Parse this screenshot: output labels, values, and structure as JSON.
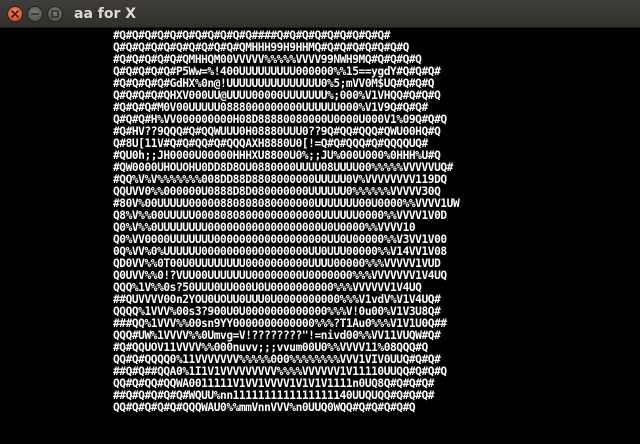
{
  "window": {
    "title": "aa for X"
  },
  "icons": {
    "close": "close-icon",
    "minimize": "minimize-icon",
    "maximize": "maximize-icon"
  },
  "colors": {
    "titlebar": "#3c3b37",
    "title_text": "#dfdbd2",
    "close_button": "#e4582f",
    "background": "#000000",
    "ascii_text": "#ffffff"
  },
  "ascii_art": [
    "#Q#Q#Q#Q#Q#Q#Q#Q#Q#Q#Q####Q#Q#Q#Q#Q#Q#Q#Q#Q#",
    "Q#Q#Q#Q#Q#Q#Q#Q#Q#Q#QMHHH99H9HHMQ#Q#Q#Q#Q#Q#Q#Q",
    "#Q#Q#Q#Q#Q#QMHHQM00VVVVV%%%%%VVVV99NWH9MQ#Q#Q#Q#Q",
    "Q#Q#Q#Q#Q#P5Ww=%!400UUUUUUUUU000000%%15==ygdY#Q#Q#Q#",
    "#Q#Q#Q#Q#GdHX%0n@!UUUUUUUUUUUUUUU0%5;mVV0M$UQ#Q#Q#Q",
    "Q#Q#Q#Q#QHXV000UU@UUUU00000UUUUUUU%;000%V1VHQQ#Q#Q#Q",
    "#Q#Q#Q#M0V00UUUUU0888000000000UUUUUU000%V1V9Q#Q#Q#",
    "Q#Q#Q#H%VV000000000H08D88880080000U0000U000V1%09Q#Q#Q",
    "#Q#HV??9QQQ#Q#QQWUUU0H08880UUU0??9Q#QQ#QQQ#QWU00HQ#Q",
    "Q#8U[11V#Q#Q#QQ#Q#QQQAXH8880U0[!=Q#Q#QQQ#Q#QQQQUQ#",
    "#QU0h;;JH0000U00000HHHXU8800U0%;;JU%000U000%0HHH%U#Q",
    "#QW0000UHOUOHU0DD8D8OU0880000UUUU08UUUU00%%%%%VVVVVUQ#",
    "#QQ%V%V%%%%%%%008DD88D8808000000UUUUU0V%VVVVVVVV119DQ",
    "QQUVV0%%000000U0888D8D080000000UUUUUU0%%%%%%VVVVV30Q",
    "#80V%00UUUUU00000880808080000000UUUUUUU00U0000%%VVVV1UW",
    "Q8%V%%00UUUUU00080808000000000000UUUUUU0000%%VVVV1V0D",
    "Q0%V%%0UUUUUUUU000000000000000000U0U0000%%VVVV10",
    "Q0%VV0000UUUUUUU000000000000000000UU0U00000%%V3VV1V00",
    "0Q%VV%0%UUUUUU00000000000000000UU0UUU00000%%V14VV1V08",
    "QD0VV%%0T00U0UUUUUUUU0000000000UUUU00000%%%VVVVV1VUD",
    "Q0UVV%%0!?VUU00UUUUUUU00000000U0000000%%%VVVVVVV1V4UQ",
    "QQQ%1V%%0s?50UUU0UU000U0U0000000000%%%VVVVVV1V4UQ",
    "##QUVVVV00n2YOU0UOUU0UUU0U0000000000%%%V1vdV%V1V4UQ#",
    "QQQQ%1VVV%00s3?900U0U0000000000000%%%V!0u00%V1V3U8Q#",
    "###QQ%1VVV%%00sn9YY0000000000000%%%?T1Au0%%%V1V1U0Q##",
    "QQQ#UW%1VVVV%%0Umvg=V!????????\"!=nivd00%%VV11VUQW#Q#",
    "#Q#QQUOV11VVVV%%000nuvv;;;vvum00U0%%VVVV11%08QQQ#Q",
    "QQ#Q#QQQQ0%11VVVVVVV%%%%%000%%%%%%%%VVV1VIV0UUQ#Q#Q#",
    "##Q#Q##QQA0%1I1V1VVVVVVVVV%%%%VVVVVV1V11110UUQQ#Q#Q#Q",
    "QQ#Q#QQ#QQWA0011111V1VV1VVVV1V1V1V1111n0UQ8Q#Q#Q#Q#",
    "##Q#Q#Q#Q#Q#WQUU%nn1111111111111111140UUQUQQ#Q#Q#Q#",
    "QQ#Q#Q#Q#Q#QQQWAU0%%mmVnnVVV%n0UUQ0WQQ#Q#Q#Q#Q#Q"
  ]
}
